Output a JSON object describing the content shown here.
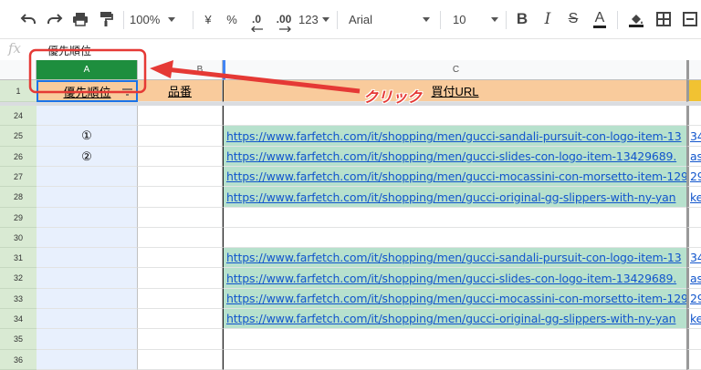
{
  "toolbar": {
    "zoom": "100%",
    "currency": "¥",
    "percent": "%",
    "decimal_decrease": ".0",
    "decimal_increase": ".00",
    "number_format": "123",
    "font_name": "Arial",
    "font_size": "10",
    "bold": "B",
    "italic": "I",
    "strikethrough": "S",
    "text_color": "A"
  },
  "formula_bar": {
    "fx": "fx",
    "value": "優先順位"
  },
  "columns": [
    {
      "label": "A"
    },
    {
      "label": "B"
    },
    {
      "label": "C"
    }
  ],
  "header_row": {
    "number": "1",
    "a": "優先順位",
    "b": "品番",
    "c": "買付URL"
  },
  "rows": [
    {
      "num": "24",
      "a": "",
      "url": "",
      "overflow": ""
    },
    {
      "num": "25",
      "a": "①",
      "url": "https://www.farfetch.com/it/shopping/men/gucci-sandali-pursuit-con-logo-item-13",
      "overflow": "34"
    },
    {
      "num": "26",
      "a": "②",
      "url": "https://www.farfetch.com/it/shopping/men/gucci-slides-con-logo-item-13429689.",
      "overflow": "as"
    },
    {
      "num": "27",
      "a": "",
      "url": "https://www.farfetch.com/it/shopping/men/gucci-mocassini-con-morsetto-item-129",
      "overflow": "29"
    },
    {
      "num": "28",
      "a": "",
      "url": "https://www.farfetch.com/it/shopping/men/gucci-original-gg-slippers-with-ny-yan",
      "overflow": "ke"
    },
    {
      "num": "29",
      "a": "",
      "url": "",
      "overflow": ""
    },
    {
      "num": "30",
      "a": "",
      "url": "",
      "overflow": ""
    },
    {
      "num": "31",
      "a": "",
      "url": "https://www.farfetch.com/it/shopping/men/gucci-sandali-pursuit-con-logo-item-13",
      "overflow": "34"
    },
    {
      "num": "32",
      "a": "",
      "url": "https://www.farfetch.com/it/shopping/men/gucci-slides-con-logo-item-13429689.",
      "overflow": "as"
    },
    {
      "num": "33",
      "a": "",
      "url": "https://www.farfetch.com/it/shopping/men/gucci-mocassini-con-morsetto-item-129",
      "overflow": "29"
    },
    {
      "num": "34",
      "a": "",
      "url": "https://www.farfetch.com/it/shopping/men/gucci-original-gg-slippers-with-ny-yan",
      "overflow": "ke"
    },
    {
      "num": "35",
      "a": "",
      "url": "",
      "overflow": ""
    },
    {
      "num": "36",
      "a": "",
      "url": "",
      "overflow": ""
    }
  ],
  "annotation": {
    "text": "クリック",
    "color": "#e53935"
  },
  "colors": {
    "header_fill": "#f9cb9c",
    "selected_col": "#1e8e3e",
    "row_header": "#d9ead3",
    "url_fill": "#b7e1cd",
    "accent": "#4285f4"
  }
}
